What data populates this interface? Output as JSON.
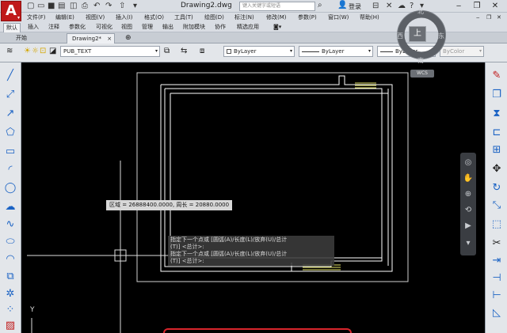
{
  "app": {
    "logo_letter": "A",
    "title": "Drawing2.dwg",
    "search_placeholder": "键入关键字或短语",
    "login_label": "登录"
  },
  "menu": [
    "文件(F)",
    "编辑(E)",
    "视图(V)",
    "插入(I)",
    "格式(O)",
    "工具(T)",
    "绘图(D)",
    "标注(N)",
    "修改(M)",
    "参数(P)",
    "窗口(W)",
    "帮助(H)"
  ],
  "ribbon_tabs": [
    "默认",
    "插入",
    "注释",
    "参数化",
    "可视化",
    "视图",
    "管理",
    "输出",
    "附加模块",
    "协作",
    "精选应用"
  ],
  "document_tabs": [
    "开始",
    "Drawing2*"
  ],
  "properties": {
    "layer_name": "PUB_TEXT",
    "color": "ByLayer",
    "linetype": "ByLayer",
    "lineweight": "ByLayer",
    "plot_style": "ByColor"
  },
  "viewcube": {
    "top": "上",
    "north": "北",
    "south": "南",
    "east": "东",
    "west": "西",
    "wcs": "WCS"
  },
  "tooltip": "区域 = 26888400.0000, 周长 = 20880.0000",
  "command_history": [
    "指定下一个点或 [圆弧(A)/长度(L)/放弃(U)/总计",
    "(T)] <总计>:",
    "指定下一个点或 [圆弧(A)/长度(L)/放弃(U)/总计",
    "(T)] <总计>:"
  ],
  "axis_label": "Y",
  "colors": {
    "accent": "#c0191a",
    "viewport_bg": "#000000",
    "drawing_line": "#ffffff",
    "hatch": "#e8e86a",
    "command_highlight": "#d9252c"
  }
}
